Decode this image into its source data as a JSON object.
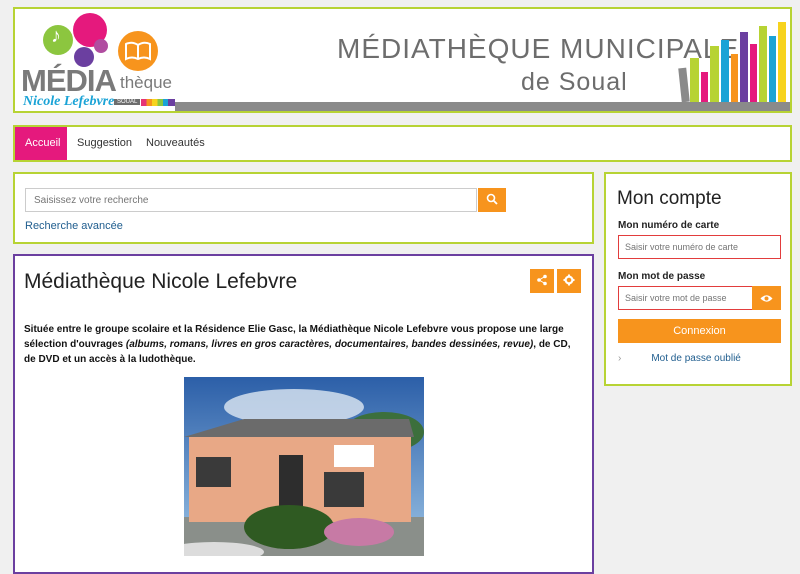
{
  "header": {
    "logo": {
      "media": "MÉDIA",
      "theque": "thèque",
      "nicole": "Nicole Lefebvre",
      "soual": "SOUAL"
    },
    "title": "MÉDIATHÈQUE MUNICIPALE",
    "subtitle": "de Soual"
  },
  "nav": {
    "items": [
      {
        "label": "Accueil"
      },
      {
        "label": "Suggestion"
      },
      {
        "label": "Nouveautés"
      }
    ]
  },
  "search": {
    "placeholder": "Saisissez votre recherche",
    "advanced_label": "Recherche avancée"
  },
  "content": {
    "title": "Médiathèque Nicole Lefebvre",
    "text_part1": "Située entre le groupe scolaire et la Résidence Elie Gasc, la Médiathèque Nicole Lefebvre vous propose une large sélection d'ouvrages ",
    "text_italic": "(albums, romans, livres en gros caractères, documentaires, bandes dessinées, revue)",
    "text_part2": ", de CD, de DVD et un accès à la ludothèque."
  },
  "account": {
    "title": "Mon compte",
    "card_label": "Mon numéro de carte",
    "card_placeholder": "Saisir votre numéro de carte",
    "password_label": "Mon mot de passe",
    "password_placeholder": "Saisir votre mot de passe",
    "login_label": "Connexion",
    "forgot_label": "Mot de passe oublié"
  },
  "colors": {
    "accent_orange": "#f7941d",
    "active_pink": "#e5197d",
    "border_green": "#b7d334",
    "border_purple": "#6b3fa0"
  },
  "icons": [
    "search-icon",
    "share-icon",
    "gear-icon",
    "eye-icon",
    "chevron-right-icon",
    "music-note-icon",
    "book-icon"
  ]
}
